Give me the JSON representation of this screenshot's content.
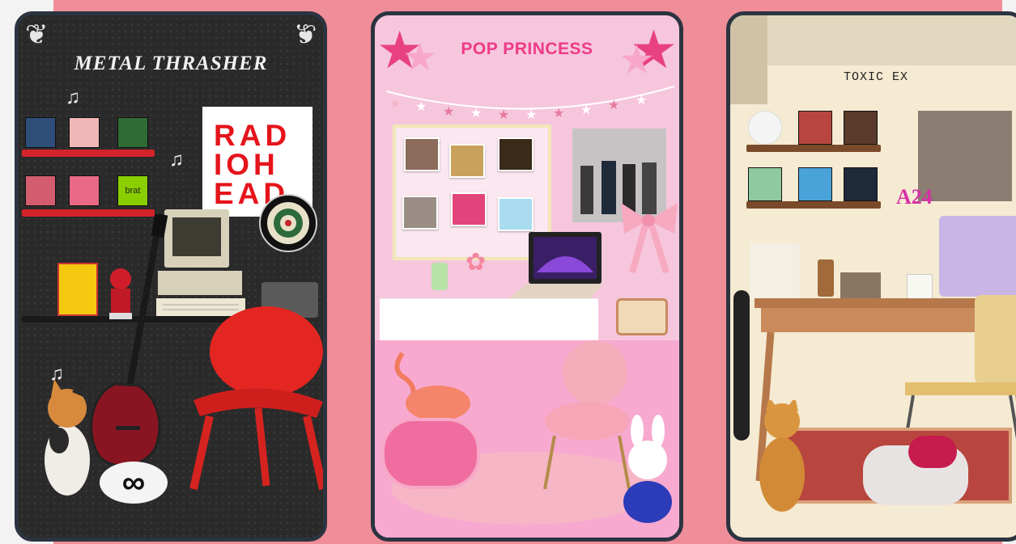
{
  "cards": [
    {
      "id": "metal",
      "title": "METAL THRASHER",
      "poster_lines": [
        "RAD",
        "IOH",
        "EAD"
      ],
      "album_green_label": "brat",
      "rug_symbol": "∞",
      "icons": [
        "music-note-icon",
        "guitar-icon",
        "computer-icon",
        "dartboard-icon",
        "chair-icon",
        "cat-icon",
        "radio-icon",
        "figure-icon"
      ]
    },
    {
      "id": "pop",
      "title": "POP PRINCESS",
      "icons": [
        "star-icon",
        "laptop-icon",
        "radio-icon",
        "flamingo-icon",
        "chair-icon",
        "bunny-icon",
        "bow-icon",
        "flower-icon"
      ]
    },
    {
      "id": "toxic",
      "title": "TOXIC EX",
      "logo_text": "A24",
      "icons": [
        "skateboard-icon",
        "cat-icon",
        "record-player-icon",
        "desk-icon",
        "chair-icon",
        "coffee-icon",
        "books-icon",
        "candle-icon"
      ]
    }
  ],
  "colors": {
    "background": "#f3f3f3",
    "pink_band": "#ef8d99",
    "card_border": "#2b3440",
    "metal_bg": "#262626",
    "pop_bg": "#f6c6dd",
    "toxic_bg": "#f5ead2",
    "accent_red": "#d3232b",
    "accent_pink": "#ee3a86"
  }
}
